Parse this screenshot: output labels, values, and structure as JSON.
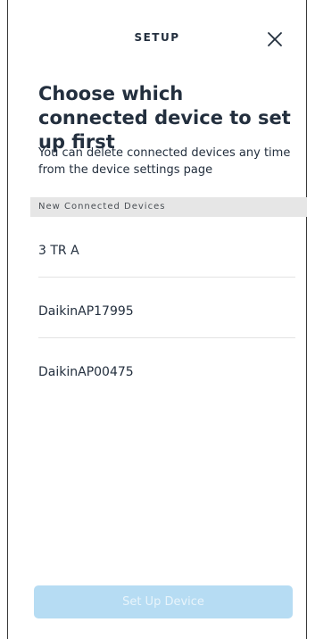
{
  "header": {
    "title": "SETUP",
    "close_icon": "close-icon"
  },
  "main": {
    "heading": "Choose which connected device to set up first",
    "description": "You can delete connected devices any time from the device settings page",
    "section_header": "New Connected Devices",
    "devices": [
      {
        "label": "3 TR A"
      },
      {
        "label": "DaikinAP17995"
      },
      {
        "label": "DaikinAP00475"
      }
    ]
  },
  "footer": {
    "button_label": "Set Up Device",
    "button_state": "disabled"
  },
  "colors": {
    "text": "#232f3e",
    "section_header_bg": "#e6e6e6",
    "button_disabled_bg": "#b6dcf3",
    "button_disabled_text": "#e8f4fb",
    "divider": "#e3e3e3"
  }
}
